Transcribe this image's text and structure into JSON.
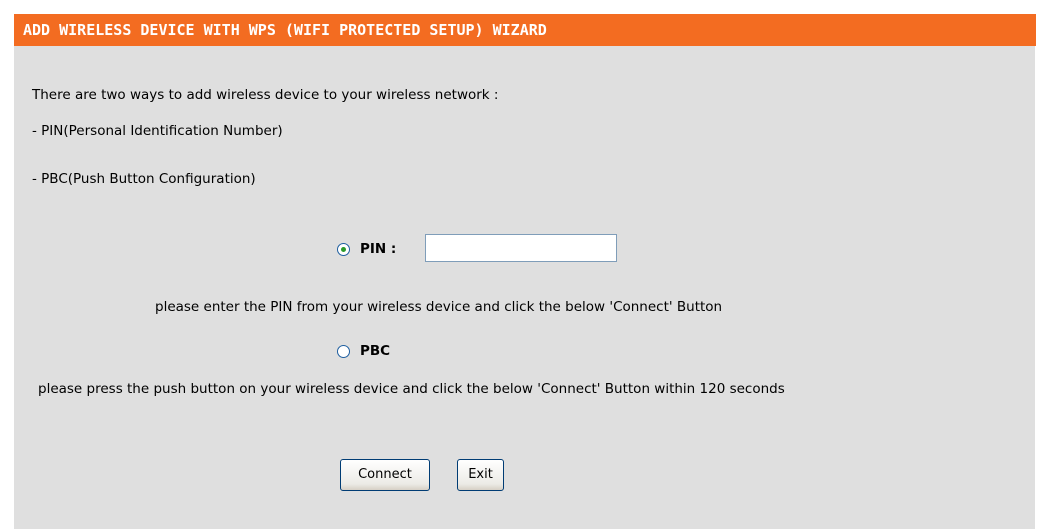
{
  "header": {
    "title": "ADD WIRELESS DEVICE WITH WPS (WIFI PROTECTED SETUP) WIZARD"
  },
  "intro": {
    "line1": "There are two ways to add wireless device to your wireless network :",
    "line2": "- PIN(Personal Identification Number)",
    "line3": "- PBC(Push Button Configuration)"
  },
  "options": {
    "pin": {
      "label": "PIN :",
      "selected": true,
      "input_value": "",
      "hint": "please enter the PIN from your wireless device and click the below 'Connect' Button"
    },
    "pbc": {
      "label": "PBC",
      "selected": false,
      "hint": "please press the push button on your wireless device and click the below 'Connect' Button within 120 seconds"
    }
  },
  "buttons": {
    "connect": "Connect",
    "exit": "Exit"
  },
  "colors": {
    "header_bg": "#f36c21",
    "panel_bg": "#dfdfdf",
    "radio_dot": "#2a9a2a"
  }
}
